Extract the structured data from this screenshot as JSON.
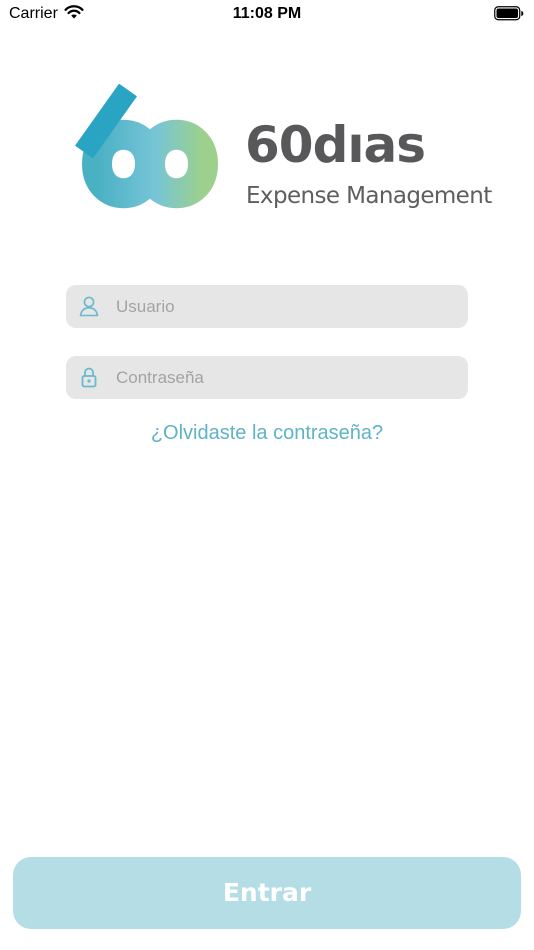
{
  "status_bar": {
    "carrier": "Carrier",
    "time": "11:08 PM",
    "wifi_icon": "wifi-icon",
    "battery_icon": "battery-icon"
  },
  "brand": {
    "name": "60dıas",
    "tagline": "Expense Management",
    "logo_colors": [
      "#1aa3bf",
      "#6ec3d6",
      "#9ccf8c"
    ],
    "text_color": "#58585a"
  },
  "login_form": {
    "username": {
      "icon": "user-icon",
      "value": "",
      "placeholder": "Usuario"
    },
    "password": {
      "icon": "lock-icon",
      "value": "",
      "placeholder": "Contraseña"
    },
    "forgot_password_label": "¿Olvidaste la contraseña?",
    "submit_label": "Entrar"
  },
  "colors": {
    "accent": "#5fb3c7",
    "field_background": "#e6e6e6",
    "button_background": "#b5dde6"
  }
}
